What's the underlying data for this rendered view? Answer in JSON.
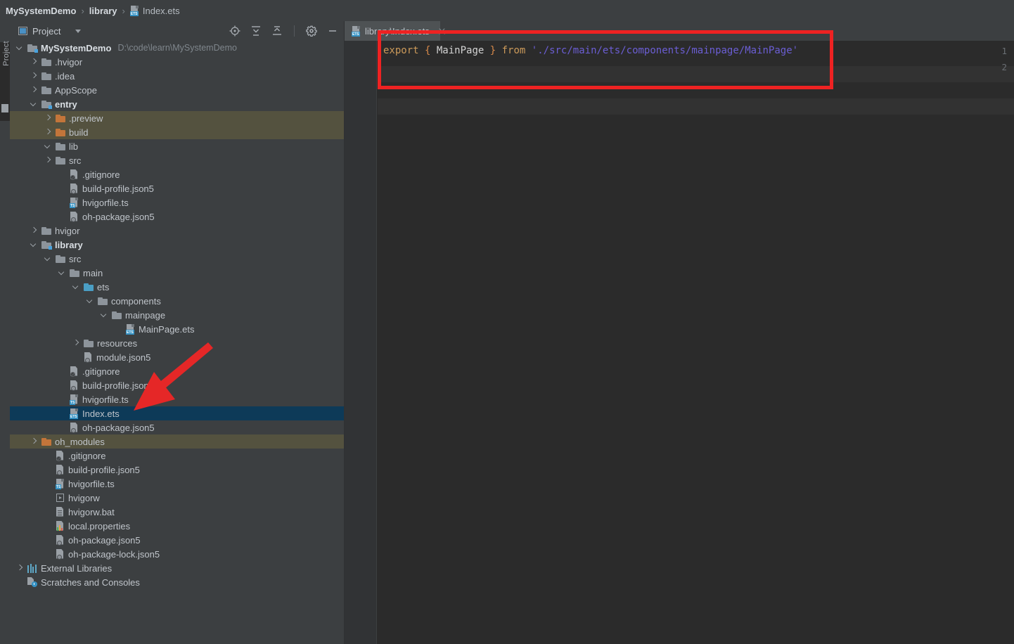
{
  "breadcrumb": {
    "project": "MySystemDemo",
    "module": "library",
    "file": "Index.ets",
    "separator": "›",
    "file_icon": "ets-file-icon"
  },
  "tool_strip": {
    "label": "Project"
  },
  "panel": {
    "title": "Project",
    "icons": {
      "project": "project-icon",
      "dropdown": "chevron-down-icon",
      "locate": "target-locate-icon",
      "expand_all": "expand-all-icon",
      "collapse_all": "collapse-all-icon",
      "settings": "gear-icon",
      "hide": "minimize-icon"
    }
  },
  "tree": [
    {
      "label": "MySystemDemo",
      "path": "D:\\code\\learn\\MySystemDemo",
      "indent": 0,
      "arrow": "down",
      "icon": "folder-module",
      "bold": true,
      "state": "normal"
    },
    {
      "label": ".hvigor",
      "indent": 1,
      "arrow": "right",
      "icon": "folder",
      "state": "normal"
    },
    {
      "label": ".idea",
      "indent": 1,
      "arrow": "right",
      "icon": "folder",
      "state": "normal"
    },
    {
      "label": "AppScope",
      "indent": 1,
      "arrow": "right",
      "icon": "folder",
      "state": "normal"
    },
    {
      "label": "entry",
      "indent": 1,
      "arrow": "down",
      "icon": "folder-module",
      "bold": true,
      "state": "normal"
    },
    {
      "label": ".preview",
      "indent": 2,
      "arrow": "right",
      "icon": "folder-orange",
      "state": "excluded"
    },
    {
      "label": "build",
      "indent": 2,
      "arrow": "right",
      "icon": "folder-orange",
      "state": "excluded"
    },
    {
      "label": "lib",
      "indent": 2,
      "arrow": "down",
      "icon": "folder",
      "state": "normal"
    },
    {
      "label": "src",
      "indent": 2,
      "arrow": "right",
      "icon": "folder",
      "state": "normal"
    },
    {
      "label": ".gitignore",
      "indent": 3,
      "arrow": "none",
      "icon": "gitignore-file-icon",
      "state": "normal"
    },
    {
      "label": "build-profile.json5",
      "indent": 3,
      "arrow": "none",
      "icon": "json5-file-icon",
      "state": "normal"
    },
    {
      "label": "hvigorfile.ts",
      "indent": 3,
      "arrow": "none",
      "icon": "ts-file-icon",
      "state": "normal"
    },
    {
      "label": "oh-package.json5",
      "indent": 3,
      "arrow": "none",
      "icon": "json5-file-icon",
      "state": "normal"
    },
    {
      "label": "hvigor",
      "indent": 1,
      "arrow": "right",
      "icon": "folder",
      "state": "normal"
    },
    {
      "label": "library",
      "indent": 1,
      "arrow": "down",
      "icon": "folder-module",
      "bold": true,
      "state": "normal"
    },
    {
      "label": "src",
      "indent": 2,
      "arrow": "down",
      "icon": "folder",
      "state": "normal"
    },
    {
      "label": "main",
      "indent": 3,
      "arrow": "down",
      "icon": "folder",
      "state": "normal"
    },
    {
      "label": "ets",
      "indent": 4,
      "arrow": "down",
      "icon": "folder-cyan",
      "state": "normal"
    },
    {
      "label": "components",
      "indent": 5,
      "arrow": "down",
      "icon": "folder",
      "state": "normal"
    },
    {
      "label": "mainpage",
      "indent": 6,
      "arrow": "down",
      "icon": "folder",
      "state": "normal"
    },
    {
      "label": "MainPage.ets",
      "indent": 7,
      "arrow": "none",
      "icon": "ets-file-icon",
      "state": "normal"
    },
    {
      "label": "resources",
      "indent": 4,
      "arrow": "right",
      "icon": "folder",
      "state": "normal"
    },
    {
      "label": "module.json5",
      "indent": 4,
      "arrow": "none",
      "icon": "json5-file-icon",
      "state": "normal"
    },
    {
      "label": ".gitignore",
      "indent": 3,
      "arrow": "none",
      "icon": "gitignore-file-icon",
      "state": "normal"
    },
    {
      "label": "build-profile.json5",
      "indent": 3,
      "arrow": "none",
      "icon": "json5-file-icon",
      "state": "normal"
    },
    {
      "label": "hvigorfile.ts",
      "indent": 3,
      "arrow": "none",
      "icon": "ts-file-icon",
      "state": "normal"
    },
    {
      "label": "Index.ets",
      "indent": 3,
      "arrow": "none",
      "icon": "ets-file-icon",
      "state": "selected"
    },
    {
      "label": "oh-package.json5",
      "indent": 3,
      "arrow": "none",
      "icon": "json5-file-icon",
      "state": "normal"
    },
    {
      "label": "oh_modules",
      "indent": 1,
      "arrow": "right",
      "icon": "folder-orange",
      "state": "excluded"
    },
    {
      "label": ".gitignore",
      "indent": 2,
      "arrow": "none",
      "icon": "gitignore-file-icon",
      "state": "normal"
    },
    {
      "label": "build-profile.json5",
      "indent": 2,
      "arrow": "none",
      "icon": "json5-file-icon",
      "state": "normal"
    },
    {
      "label": "hvigorfile.ts",
      "indent": 2,
      "arrow": "none",
      "icon": "ts-file-icon",
      "state": "normal"
    },
    {
      "label": "hvigorw",
      "indent": 2,
      "arrow": "none",
      "icon": "run-file-icon",
      "state": "normal"
    },
    {
      "label": "hvigorw.bat",
      "indent": 2,
      "arrow": "none",
      "icon": "bat-file-icon",
      "state": "normal"
    },
    {
      "label": "local.properties",
      "indent": 2,
      "arrow": "none",
      "icon": "properties-file-icon",
      "state": "normal"
    },
    {
      "label": "oh-package.json5",
      "indent": 2,
      "arrow": "none",
      "icon": "json5-file-icon",
      "state": "normal"
    },
    {
      "label": "oh-package-lock.json5",
      "indent": 2,
      "arrow": "none",
      "icon": "json5-file-icon",
      "state": "normal"
    },
    {
      "label": "External Libraries",
      "indent": 0,
      "arrow": "right",
      "icon": "external-libraries-icon",
      "state": "normal"
    },
    {
      "label": "Scratches and Consoles",
      "indent": 0,
      "arrow": "none",
      "icon": "scratches-icon",
      "state": "normal"
    }
  ],
  "editor": {
    "tab": {
      "title": "library\\Index.ets",
      "icon": "ets-file-icon",
      "close": "close-icon"
    },
    "line_numbers": [
      "1",
      "2"
    ],
    "code": {
      "tokens": [
        {
          "text": "export",
          "type": "keyword"
        },
        {
          "text": " ",
          "type": "plain"
        },
        {
          "text": "{",
          "type": "brace"
        },
        {
          "text": " MainPage ",
          "type": "identifier"
        },
        {
          "text": "}",
          "type": "brace"
        },
        {
          "text": " ",
          "type": "plain"
        },
        {
          "text": "from",
          "type": "keyword"
        },
        {
          "text": " ",
          "type": "plain"
        },
        {
          "text": "'./src/main/ets/components/mainpage/MainPage'",
          "type": "string"
        }
      ]
    }
  },
  "annotations": {
    "highlight_box_color": "#ee2222",
    "arrow_color": "#e52727"
  },
  "colors": {
    "panel_bg": "#3c3f41",
    "editor_bg": "#2b2b2b",
    "selection": "#0d3a58",
    "excluded_row": "#54523f",
    "keyword": "#cc9a5a",
    "string": "#6b5ed4",
    "brace": "#d98a4a"
  }
}
